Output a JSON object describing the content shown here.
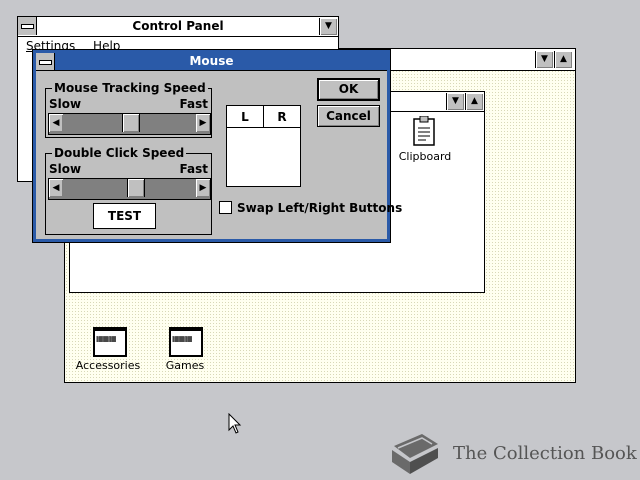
{
  "control_panel": {
    "title": "Control Panel",
    "menu": [
      "Settings",
      "Help"
    ]
  },
  "program_manager": {
    "icons": [
      {
        "label": "Accessories",
        "icon": "program-group-icon"
      },
      {
        "label": "Games",
        "icon": "program-group-icon"
      }
    ]
  },
  "group_window": {
    "icons": [
      {
        "label": "Clipboard",
        "icon": "clipboard-icon"
      }
    ]
  },
  "mouse_dialog": {
    "title": "Mouse",
    "tracking": {
      "label": "Mouse Tracking Speed",
      "slow": "Slow",
      "fast": "Fast",
      "level": 0.5
    },
    "double_click": {
      "label": "Double Click Speed",
      "slow": "Slow",
      "fast": "Fast",
      "level": 0.55
    },
    "test_label": "TEST",
    "buttons_left": "L",
    "buttons_right": "R",
    "swap_label": "Swap Left/Right Buttons",
    "swap_checked": false,
    "ok_label": "OK",
    "cancel_label": "Cancel"
  },
  "watermark": {
    "text": "The Collection Book",
    "icon": "book-icon"
  },
  "colors": {
    "desktop": "#c6c7cb",
    "active_title": "#2a5aa8",
    "dialog_face": "#c0c0c0",
    "workspace": "#fffff0"
  }
}
